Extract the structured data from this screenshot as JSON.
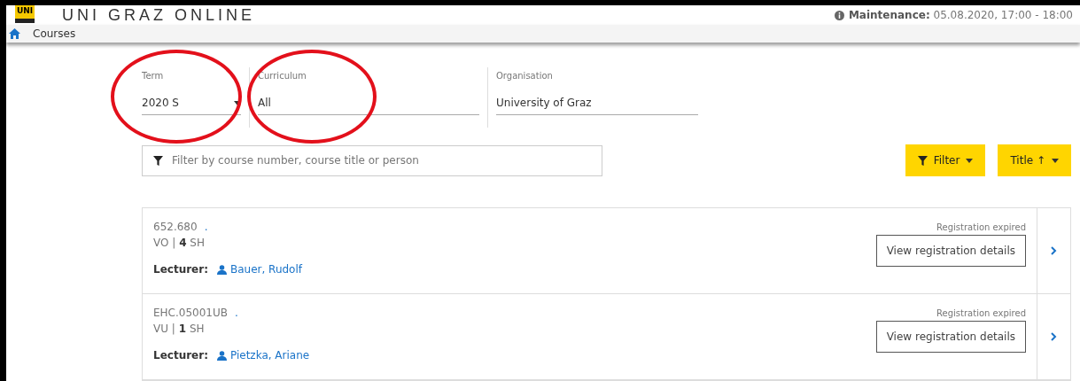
{
  "header": {
    "logo_text": "UNI",
    "title": "UNI GRAZ ONLINE",
    "maintenance_label": "Maintenance:",
    "maintenance_text": "05.08.2020, 17:00 - 18:00"
  },
  "nav": {
    "label": "Courses"
  },
  "fields": [
    {
      "kind": "select",
      "label": "Term",
      "value": "2020 S",
      "circled": true
    },
    {
      "kind": "text",
      "label": "Curriculum",
      "value": "All",
      "circled": true
    },
    {
      "kind": "text",
      "label": "Organisation",
      "value": "University of Graz"
    }
  ],
  "search": {
    "placeholder": "Filter by course number, course title or person"
  },
  "buttons": [
    {
      "kind": "filter",
      "label": "Filter"
    },
    {
      "kind": "sort",
      "label": "Title ↑"
    }
  ],
  "courses": [
    {
      "number": "652.680",
      "dot": ".",
      "type": "VO",
      "separator": "|",
      "hours": "4",
      "unit": "SH",
      "lecturer_label": "Lecturer:",
      "lecturer": "Bauer, Rudolf",
      "status": "Registration expired",
      "action": "View registration details"
    },
    {
      "number": "EHC.05001UB",
      "dot": ".",
      "type": "VU",
      "separator": "|",
      "hours": "1",
      "unit": "SH",
      "lecturer_label": "Lecturer:",
      "lecturer": "Pietzka, Ariane",
      "status": "Registration expired",
      "action": "View registration details"
    }
  ]
}
